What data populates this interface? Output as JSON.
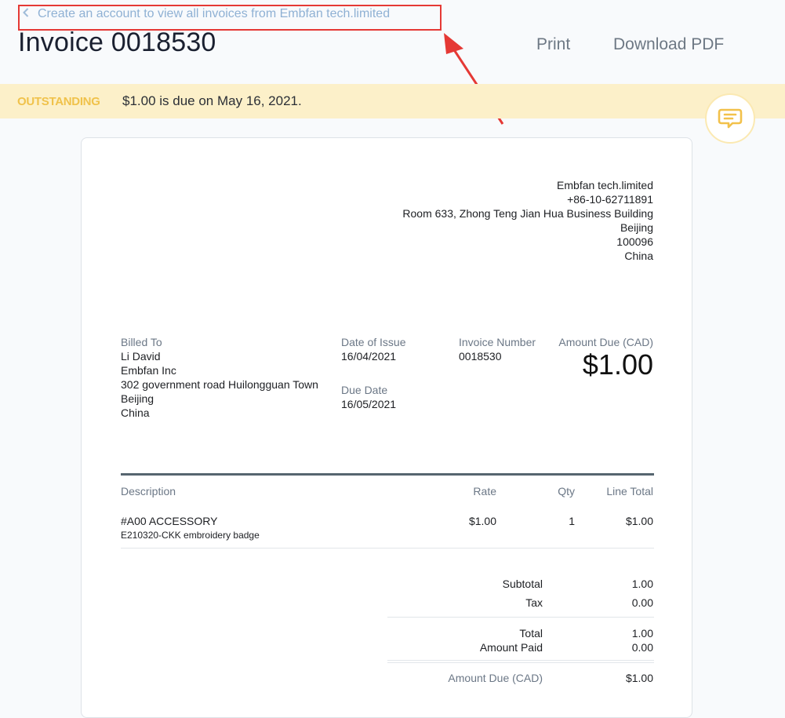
{
  "back_link": {
    "label": "Create an account to view all invoices from Embfan tech.limited",
    "icon": "chevron-left-icon"
  },
  "header": {
    "title": "Invoice 0018530",
    "print_label": "Print",
    "download_label": "Download PDF"
  },
  "status": {
    "badge": "OUTSTANDING",
    "message": "$1.00 is due on May 16, 2021."
  },
  "chat": {
    "icon": "chat-bubble-icon"
  },
  "company": {
    "lines": [
      "Embfan tech.limited",
      "+86-10-62711891",
      "Room 633, Zhong Teng Jian Hua Business Building",
      "Beijing",
      "100096",
      "China"
    ]
  },
  "billed_to": {
    "label": "Billed To",
    "lines": [
      "Li David",
      "Embfan Inc",
      "302 government road Huilongguan Town",
      "Beijing",
      "China"
    ]
  },
  "issue": {
    "label": "Date of Issue",
    "value": "16/04/2021"
  },
  "due": {
    "label": "Due Date",
    "value": "16/05/2021"
  },
  "invoice_number": {
    "label": "Invoice Number",
    "value": "0018530"
  },
  "amount_due": {
    "label": "Amount Due (CAD)",
    "value": "$1.00"
  },
  "table": {
    "headers": {
      "description": "Description",
      "rate": "Rate",
      "qty": "Qty",
      "line_total": "Line Total"
    },
    "rows": [
      {
        "title": "#A00 ACCESSORY",
        "subtitle": "E210320-CKK embroidery badge",
        "rate": "$1.00",
        "qty": "1",
        "line_total": "$1.00"
      }
    ]
  },
  "totals": {
    "subtotal_label": "Subtotal",
    "subtotal": "1.00",
    "tax_label": "Tax",
    "tax": "0.00",
    "total_label": "Total",
    "total": "1.00",
    "paid_label": "Amount Paid",
    "paid": "0.00",
    "due_label": "Amount Due (CAD)",
    "due": "$1.00"
  },
  "colors": {
    "accent_status": "#f0c24b",
    "status_bg": "#fcf0c9",
    "annotation": "#e53935",
    "link": "#8fb1d4"
  }
}
